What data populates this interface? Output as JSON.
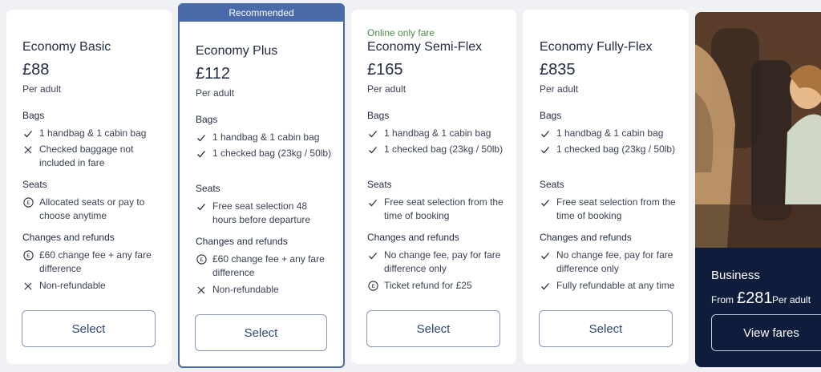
{
  "colors": {
    "background": "#eff1f5",
    "card": "#ffffff",
    "recommended_accent": "#4a6aa8",
    "online_only_green": "#4c8a4c",
    "business_panel": "#0f1d3d"
  },
  "fares": [
    {
      "title": "Economy Basic",
      "price": "£88",
      "per": "Per adult",
      "bags_label": "Bags",
      "bags": [
        {
          "icon": "check-icon",
          "text": "1 handbag & 1 cabin bag"
        },
        {
          "icon": "cross-icon",
          "text": "Checked baggage not included in fare"
        }
      ],
      "seats_label": "Seats",
      "seats": [
        {
          "icon": "pound-circle-icon",
          "text": "Allocated seats or pay to choose anytime"
        }
      ],
      "changes_label": "Changes and refunds",
      "changes": [
        {
          "icon": "pound-circle-icon",
          "text": "£60 change fee + any fare difference"
        },
        {
          "icon": "cross-icon",
          "text": "Non-refundable"
        }
      ],
      "select_label": "Select"
    },
    {
      "badge": "Recommended",
      "title": "Economy Plus",
      "price": "£112",
      "per": "Per adult",
      "bags_label": "Bags",
      "bags": [
        {
          "icon": "check-icon",
          "text": "1 handbag & 1 cabin bag"
        },
        {
          "icon": "check-icon",
          "text": "1 checked bag (23kg / 50lb)"
        }
      ],
      "seats_label": "Seats",
      "seats": [
        {
          "icon": "check-icon",
          "text": "Free seat selection 48 hours before departure"
        }
      ],
      "changes_label": "Changes and refunds",
      "changes": [
        {
          "icon": "pound-circle-icon",
          "text": "£60 change fee + any fare difference"
        },
        {
          "icon": "cross-icon",
          "text": "Non-refundable"
        }
      ],
      "select_label": "Select"
    },
    {
      "note": "Online only fare",
      "title": "Economy Semi-Flex",
      "price": "£165",
      "per": "Per adult",
      "bags_label": "Bags",
      "bags": [
        {
          "icon": "check-icon",
          "text": "1 handbag & 1 cabin bag"
        },
        {
          "icon": "check-icon",
          "text": "1 checked bag (23kg / 50lb)"
        }
      ],
      "seats_label": "Seats",
      "seats": [
        {
          "icon": "check-icon",
          "text": "Free seat selection from the time of booking"
        }
      ],
      "changes_label": "Changes and refunds",
      "changes": [
        {
          "icon": "check-icon",
          "text": "No change fee, pay for fare difference only"
        },
        {
          "icon": "pound-circle-icon",
          "text": "Ticket refund for £25"
        }
      ],
      "select_label": "Select"
    },
    {
      "title": "Economy Fully-Flex",
      "price": "£835",
      "per": "Per adult",
      "bags_label": "Bags",
      "bags": [
        {
          "icon": "check-icon",
          "text": "1 handbag & 1 cabin bag"
        },
        {
          "icon": "check-icon",
          "text": "1 checked bag (23kg / 50lb)"
        }
      ],
      "seats_label": "Seats",
      "seats": [
        {
          "icon": "check-icon",
          "text": "Free seat selection from the time of booking"
        }
      ],
      "changes_label": "Changes and refunds",
      "changes": [
        {
          "icon": "check-icon",
          "text": "No change fee, pay for fare difference only"
        },
        {
          "icon": "check-icon",
          "text": "Fully refundable at any time"
        }
      ],
      "select_label": "Select"
    }
  ],
  "business": {
    "title": "Business",
    "from": "From",
    "price": "£281",
    "per": "Per adult",
    "button_label": "View fares"
  }
}
